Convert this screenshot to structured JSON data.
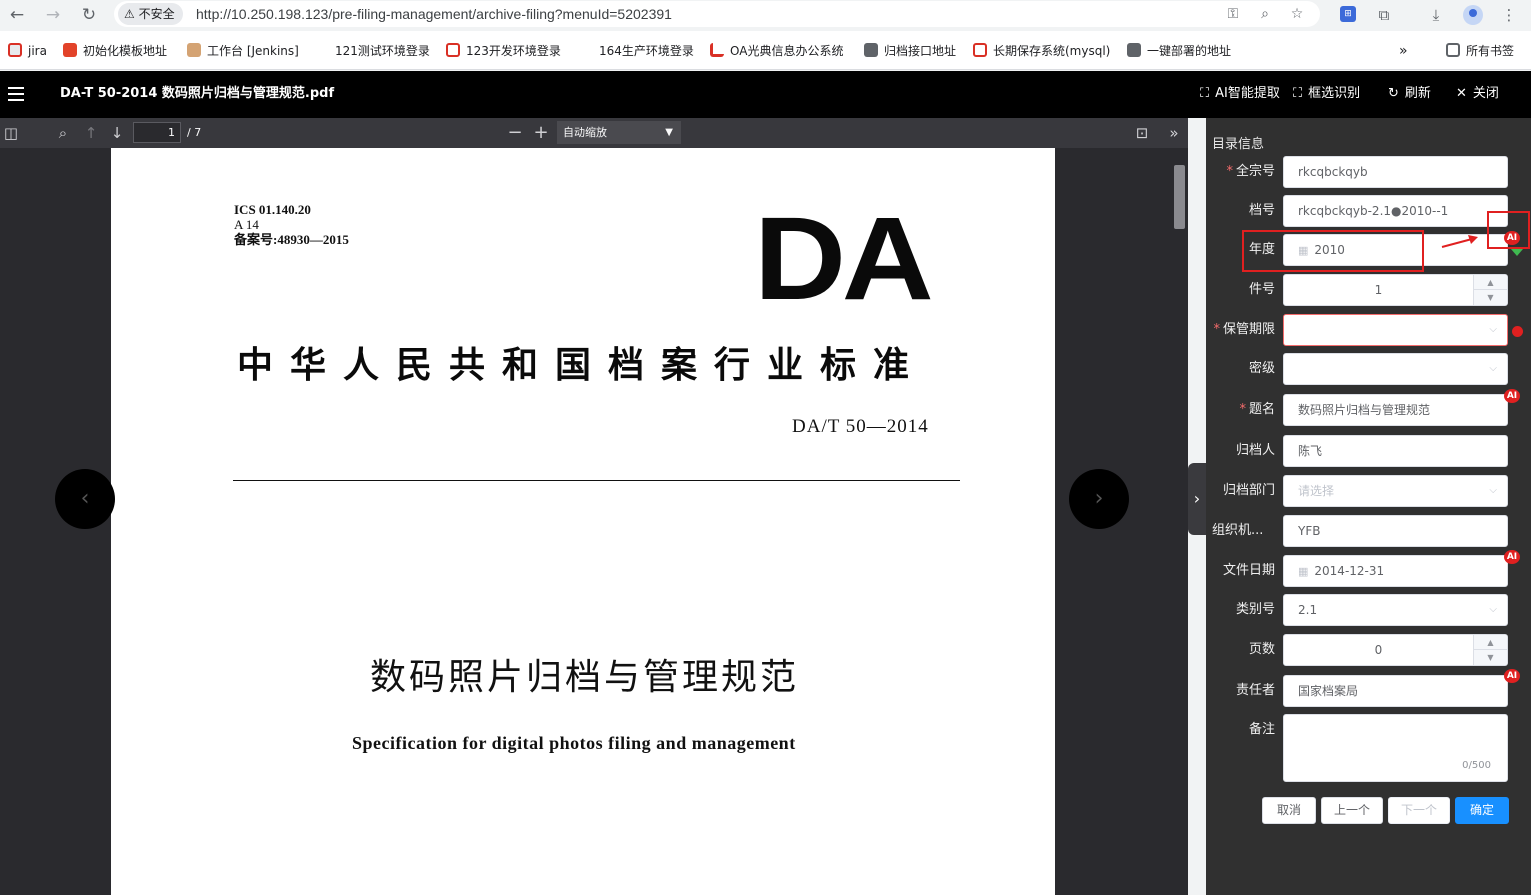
{
  "browser": {
    "insecure_label": "不安全",
    "url": "http://10.250.198.123/pre-filing-management/archive-filing?menuId=5202391",
    "ext_label": "⊞"
  },
  "bookmarks": [
    {
      "label": "jira",
      "icon": "jira-icon"
    },
    {
      "label": "初始化模板地址",
      "icon": "gitlab-icon"
    },
    {
      "label": "工作台 [Jenkins]",
      "icon": "jenkins-icon"
    },
    {
      "label": "121测试环境登录",
      "icon": "none"
    },
    {
      "label": "123开发环境登录",
      "icon": "bookmark-red-icon"
    },
    {
      "label": "164生产环境登录",
      "icon": "none"
    },
    {
      "label": "OA光典信息办公系统",
      "icon": "oa-icon"
    },
    {
      "label": "归档接口地址",
      "icon": "globe-icon"
    },
    {
      "label": "长期保存系统(mysql)",
      "icon": "bookmark-red-icon"
    },
    {
      "label": "一键部署的地址",
      "icon": "globe-icon"
    }
  ],
  "bookmarks_more": "»",
  "bookmarks_all": "所有书签",
  "app": {
    "doc_title": "DA-T 50-2014 数码照片归档与管理规范.pdf",
    "actions": {
      "ai_extract": "AI智能提取",
      "box_recognize": "框选识别",
      "refresh": "刷新",
      "close": "关闭"
    }
  },
  "pdf": {
    "page_current": "1",
    "page_total": "/ 7",
    "zoom": "自动缩放",
    "content": {
      "ics_line1": "ICS  01.140.20",
      "ics_line2": "A  14",
      "ics_line3": "备案号:48930—2015",
      "logo": "DA",
      "standard_title": "中华人民共和国档案行业标准",
      "standard_number": "DA/T 50—2014",
      "main_title": "数码照片归档与管理规范",
      "sub_title": "Specification for digital photos filing and management"
    }
  },
  "form": {
    "section_title": "目录信息",
    "fields": {
      "fonds_no": {
        "label": "全宗号",
        "value": "rkcqbckqyb"
      },
      "archive_no": {
        "label": "档号",
        "value": "rkcqbckqyb-2.1●2010--1"
      },
      "year": {
        "label": "年度",
        "value": "2010"
      },
      "item_no": {
        "label": "件号",
        "value": "1"
      },
      "retention": {
        "label": "保管期限",
        "value": ""
      },
      "security": {
        "label": "密级",
        "value": ""
      },
      "title": {
        "label": "题名",
        "value": "数码照片归档与管理规范"
      },
      "filer": {
        "label": "归档人",
        "value": "陈飞"
      },
      "department": {
        "label": "归档部门",
        "placeholder": "请选择"
      },
      "org": {
        "label": "组织机...",
        "value": "YFB"
      },
      "doc_date": {
        "label": "文件日期",
        "value": "2014-12-31"
      },
      "category": {
        "label": "类别号",
        "value": "2.1"
      },
      "pages": {
        "label": "页数",
        "value": "0"
      },
      "responsible": {
        "label": "责任者",
        "value": "国家档案局"
      },
      "remark": {
        "label": "备注",
        "count": "0/500"
      }
    },
    "ai_badge": "AI",
    "buttons": {
      "cancel": "取消",
      "prev": "上一个",
      "next": "下一个",
      "confirm": "确定"
    }
  },
  "colors": {
    "primary": "#1890ff",
    "error": "#f56c6c",
    "annotation": "#e02020",
    "panel_bg": "#303030",
    "pdf_bg": "#2a2a2e"
  }
}
